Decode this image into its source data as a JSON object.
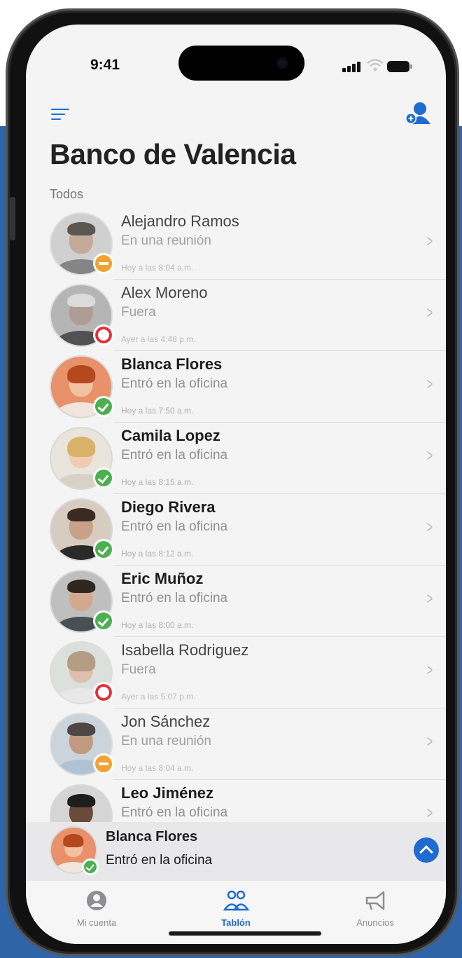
{
  "status_bar": {
    "time": "9:41"
  },
  "header": {
    "title": "Banco de Valencia",
    "section_label": "Todos"
  },
  "colors": {
    "accent": "#1f6bd1",
    "meeting": "#f0a231",
    "out": "#e0303a",
    "office": "#4caf50"
  },
  "people": [
    {
      "name": "Alejandro Ramos",
      "status": "En una reunión",
      "time": "Hoy a las 8:04 a.m.",
      "state": "meeting"
    },
    {
      "name": "Alex Moreno",
      "status": "Fuera",
      "time": "Ayer a las 4:48 p.m.",
      "state": "out"
    },
    {
      "name": "Blanca Flores",
      "status": "Entró en la oficina",
      "time": "Hoy a las 7:50 a.m.",
      "state": "office"
    },
    {
      "name": "Camila Lopez",
      "status": "Entró en la oficina",
      "time": "Hoy a las 8:15 a.m.",
      "state": "office"
    },
    {
      "name": "Diego Rivera",
      "status": "Entró en la oficina",
      "time": "Hoy a las 8:12 a.m.",
      "state": "office"
    },
    {
      "name": "Eric Muñoz",
      "status": "Entró en la oficina",
      "time": "Hoy a las 8:00 a.m.",
      "state": "office"
    },
    {
      "name": "Isabella Rodriguez",
      "status": "Fuera",
      "time": "Ayer a las 5:07 p.m.",
      "state": "out"
    },
    {
      "name": "Jon Sánchez",
      "status": "En una reunión",
      "time": "Hoy a las 8:04 a.m.",
      "state": "meeting"
    },
    {
      "name": "Leo Jiménez",
      "status": "Entró en la oficina",
      "time": "",
      "state": "office"
    }
  ],
  "current_user": {
    "name": "Blanca Flores",
    "status": "Entró en la oficina"
  },
  "tabs": [
    {
      "label": "Mi cuenta",
      "icon": "account-icon"
    },
    {
      "label": "Tablón",
      "icon": "people-icon"
    },
    {
      "label": "Anuncios",
      "icon": "megaphone-icon"
    }
  ]
}
